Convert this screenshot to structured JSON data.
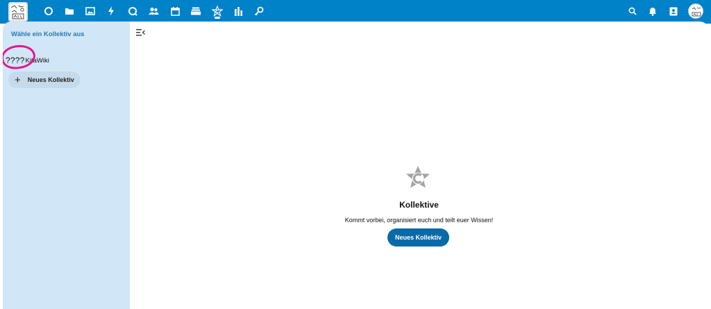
{
  "colors": {
    "brand": "#0082c9",
    "sidebar_bg": "#d1e6f6",
    "sidebar_title": "#2a7bb0",
    "primary_button": "#0a6aa8",
    "annotation": "#e6178d"
  },
  "header": {
    "logo_icon": "kita-logo-icon",
    "apps": [
      {
        "name": "dashboard-circle-icon"
      },
      {
        "name": "files-folder-icon"
      },
      {
        "name": "photos-image-icon"
      },
      {
        "name": "activity-bolt-icon"
      },
      {
        "name": "talk-chat-icon"
      },
      {
        "name": "contacts-people-icon"
      },
      {
        "name": "calendar-icon"
      },
      {
        "name": "deck-archive-icon"
      },
      {
        "name": "collectives-star-icon"
      },
      {
        "name": "analytics-bars-icon"
      },
      {
        "name": "passwords-key-icon"
      }
    ],
    "right_icons": [
      {
        "name": "search-icon"
      },
      {
        "name": "notifications-bell-icon"
      },
      {
        "name": "contacts-menu-icon"
      }
    ]
  },
  "sidebar": {
    "title": "Wähle ein Kollektiv aus",
    "collectives": [
      {
        "emoji": "????",
        "name": "KitaWiki"
      }
    ],
    "new_button": {
      "plus": "+",
      "label": "Neues Kollektiv"
    }
  },
  "empty_state": {
    "title": "Kollektive",
    "description": "Kommt vorbei, organisiert euch und teilt euer Wissen!",
    "button_label": "Neues Kollektiv"
  }
}
